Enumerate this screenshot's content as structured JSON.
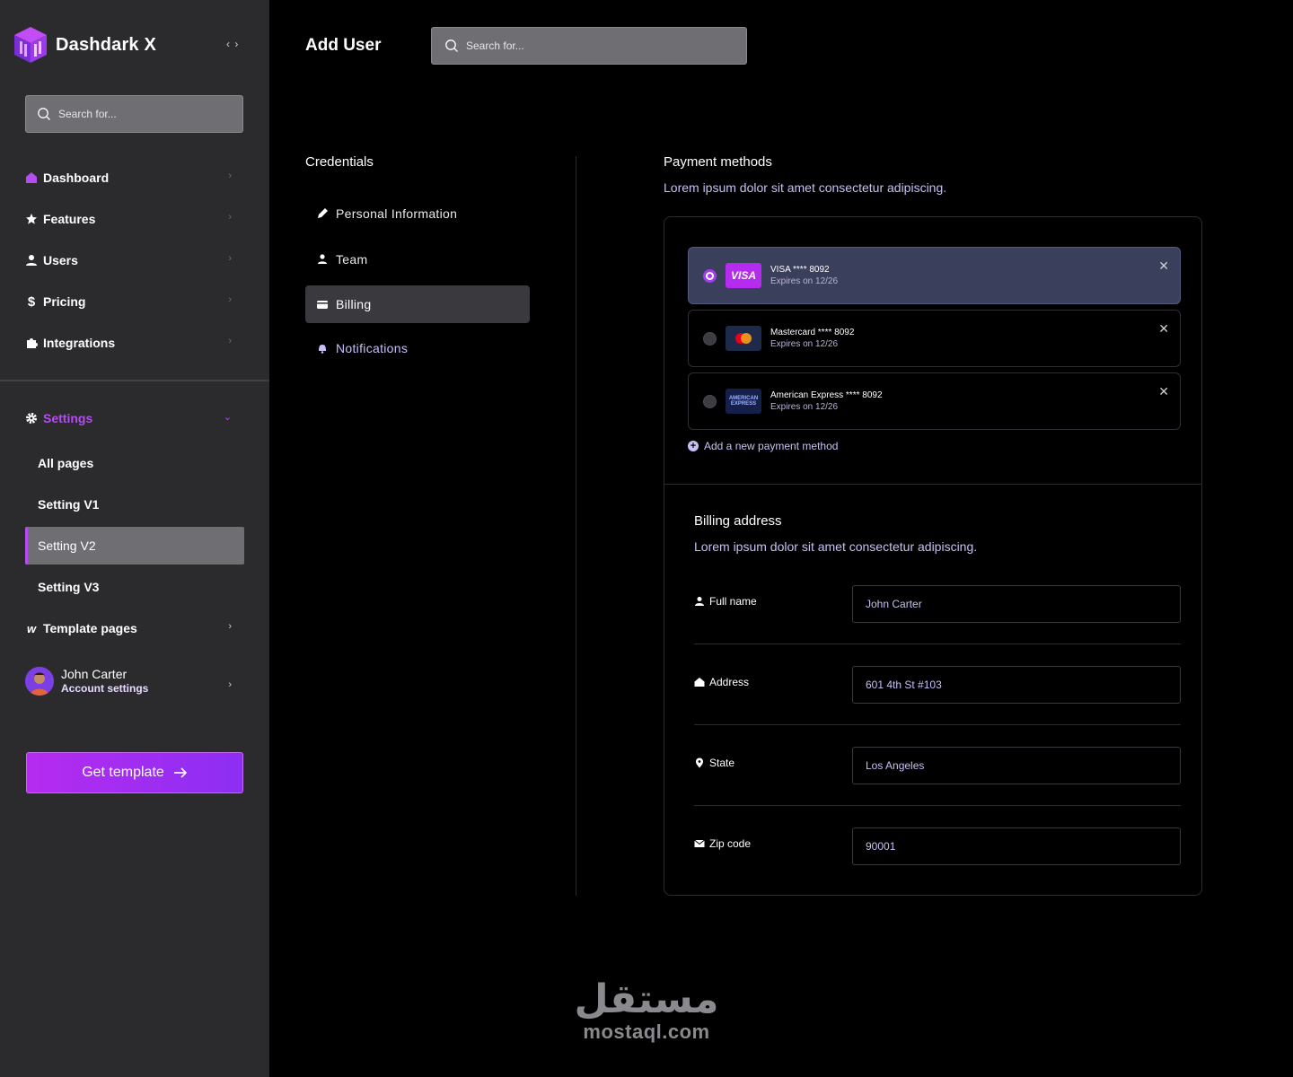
{
  "brand": {
    "name": "Dashdark X",
    "toggle": "‹ ›"
  },
  "sidebar": {
    "search_placeholder": "Search for...",
    "items": [
      {
        "label": "Dashboard"
      },
      {
        "label": "Features"
      },
      {
        "label": "Users"
      },
      {
        "label": "Pricing"
      },
      {
        "label": "Integrations"
      }
    ],
    "settings": {
      "label": "Settings",
      "subitems": [
        "All pages",
        "Setting V1",
        "Setting V2",
        "Setting V3"
      ],
      "active": "Setting V2"
    },
    "template_pages": "Template pages",
    "account": {
      "name": "John Carter",
      "subtitle": "Account settings"
    },
    "cta": "Get template"
  },
  "header": {
    "title": "Add User",
    "search_placeholder": "Search for..."
  },
  "credentials": {
    "title": "Credentials",
    "items": [
      {
        "label": "Personal Information"
      },
      {
        "label": "Team"
      },
      {
        "label": "Billing"
      },
      {
        "label": "Notifications"
      }
    ],
    "active": "Billing"
  },
  "payment": {
    "title": "Payment methods",
    "subtitle": "Lorem ipsum dolor sit amet consectetur adipiscing.",
    "cards": [
      {
        "name": "VISA **** 8092",
        "expires": "Expires on 12/26",
        "brand": "VISA",
        "selected": true
      },
      {
        "name": "Mastercard **** 8092",
        "expires": "Expires on 12/26",
        "brand": "Mastercard",
        "selected": false
      },
      {
        "name": "American Express **** 8092",
        "expires": "Expires on 12/26",
        "brand": "AMERICAN EXPRESS",
        "selected": false
      }
    ],
    "add_label": "Add a new payment method"
  },
  "billing": {
    "title": "Billing address",
    "subtitle": "Lorem ipsum dolor sit amet consectetur adipiscing.",
    "fields": [
      {
        "label": "Full name",
        "value": "John Carter"
      },
      {
        "label": "Address",
        "value": "601 4th St #103"
      },
      {
        "label": "State",
        "value": "Los Angeles"
      },
      {
        "label": "Zip code",
        "value": "90001"
      }
    ]
  },
  "watermark": {
    "arabic": "مستقل",
    "latin": "mostaql.com"
  },
  "colors": {
    "accent": "#b44cf2",
    "sidebar_bg": "#2b2b2e",
    "selected_card": "#3a3f5b",
    "muted_text": "#c9bff5"
  }
}
